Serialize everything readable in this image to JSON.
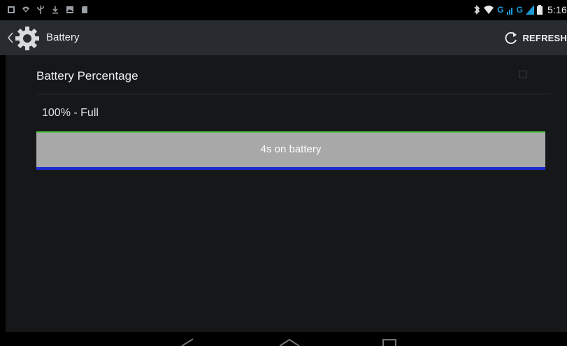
{
  "status_bar": {
    "time": "5:16",
    "network_label": "G",
    "left_icons": [
      "notification-icon",
      "wifi-signal-icon",
      "usb-icon",
      "download-icon",
      "screenshot-icon",
      "sd-card-icon"
    ],
    "right_icons": [
      "bluetooth-icon",
      "wifi-icon",
      "cell-signal-icon",
      "cell-signal-icon-2",
      "battery-icon"
    ]
  },
  "action_bar": {
    "title": "Battery",
    "refresh_label": "REFRESH"
  },
  "preference": {
    "title": "Battery Percentage",
    "checked": false
  },
  "battery": {
    "level_text": "100% - Full",
    "level_percent": 100,
    "graph_label": "4s on battery"
  },
  "colors": {
    "status_bar": "#000000",
    "action_bar": "#282b2f",
    "content_bg": "#151719",
    "graph_fill": "#a8a8a8",
    "graph_top_line": "#5ac84a",
    "graph_bottom_line": "#1c2ad2",
    "network_accent": "#1e9bd7"
  },
  "navigation": {
    "icons": [
      "back-icon",
      "home-icon",
      "recents-icon"
    ]
  }
}
